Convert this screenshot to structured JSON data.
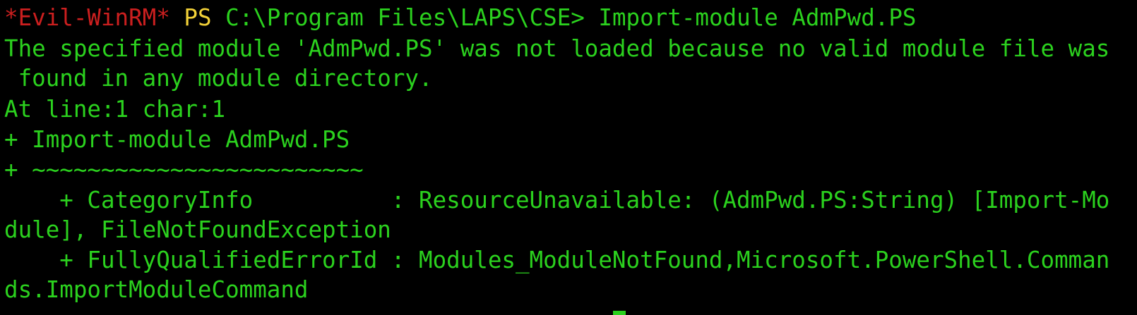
{
  "terminal": {
    "prompt_tag": "*Evil-WinRM*",
    "prompt_ps": "PS",
    "prompt_path": "C:\\Program Files\\LAPS\\CSE>",
    "command": "Import-module AdmPwd.PS",
    "output_lines": [
      "The specified module 'AdmPwd.PS' was not loaded because no valid module file was",
      " found in any module directory.",
      "At line:1 char:1",
      "+ Import-module AdmPwd.PS",
      "+ ~~~~~~~~~~~~~~~~~~~~~~~~",
      "    + CategoryInfo          : ResourceUnavailable: (AdmPwd.PS:String) [Import-Mo",
      "dule], FileNotFoundException",
      "    + FullyQualifiedErrorId : Modules_ModuleNotFound,Microsoft.PowerShell.Comman",
      "ds.ImportModuleCommand"
    ]
  },
  "colors": {
    "background": "#000000",
    "prompt_tag": "#cc1f1f",
    "prompt_ps": "#f2d138",
    "text": "#2bd11e"
  }
}
